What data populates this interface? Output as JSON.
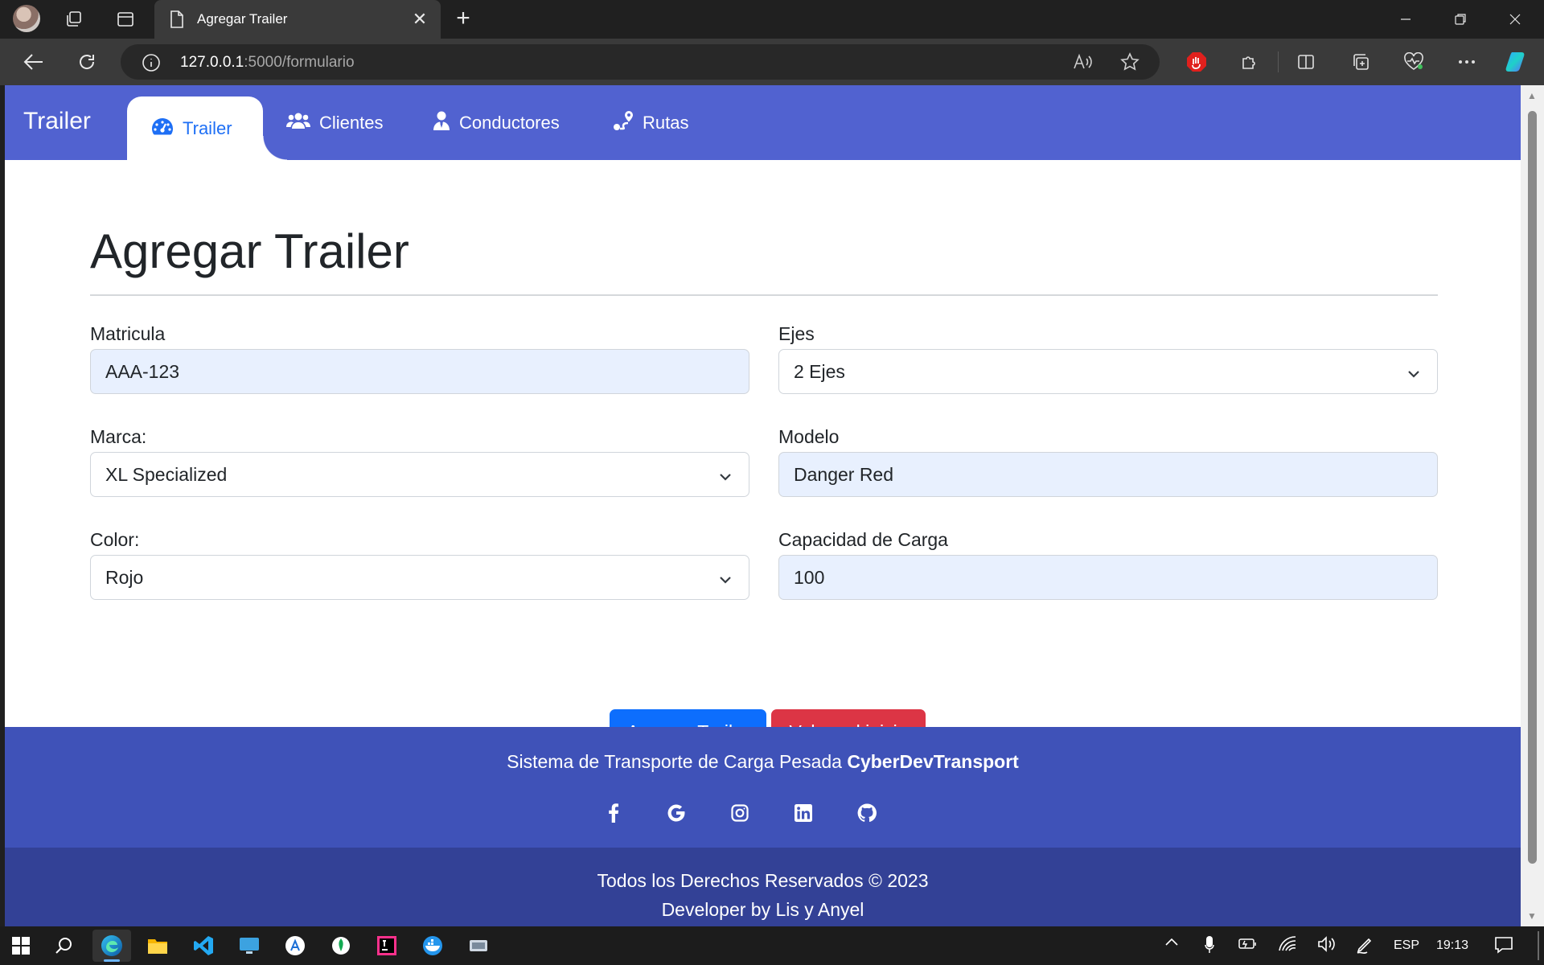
{
  "browser": {
    "tab_title": "Agregar Trailer",
    "url_host": "127.0.0.1",
    "url_rest": ":5000/formulario"
  },
  "app": {
    "brand": "Trailer",
    "nav": [
      {
        "label": "Trailer",
        "icon": "gauge-icon",
        "active": true
      },
      {
        "label": "Clientes",
        "icon": "users-icon",
        "active": false
      },
      {
        "label": "Conductores",
        "icon": "user-tie-icon",
        "active": false
      },
      {
        "label": "Rutas",
        "icon": "route-icon",
        "active": false
      }
    ],
    "accent_color": "#5162d0",
    "active_link_color": "#1e6ff5"
  },
  "form": {
    "title": "Agregar Trailer",
    "matricula": {
      "label": "Matricula",
      "value": "AAA-123"
    },
    "ejes": {
      "label": "Ejes",
      "value": "2 Ejes"
    },
    "marca": {
      "label": "Marca:",
      "value": "XL Specialized"
    },
    "modelo": {
      "label": "Modelo",
      "value": "Danger Red"
    },
    "color": {
      "label": "Color:",
      "value": "Rojo"
    },
    "capacidad": {
      "label": "Capacidad de Carga",
      "value": "100"
    },
    "submit_label": "Agregar Trailer",
    "back_label": "Volver al inicio"
  },
  "footer": {
    "tagline": "Sistema de Transporte de Carga Pesada",
    "company": "CyberDevTransport",
    "social": [
      "facebook-icon",
      "google-icon",
      "instagram-icon",
      "linkedin-icon",
      "github-icon"
    ],
    "rights": "Todos los Derechos Reservados © 2023",
    "developer": "Developer by Lis y Anyel"
  },
  "taskbar": {
    "language": "ESP",
    "time": "19:13"
  }
}
